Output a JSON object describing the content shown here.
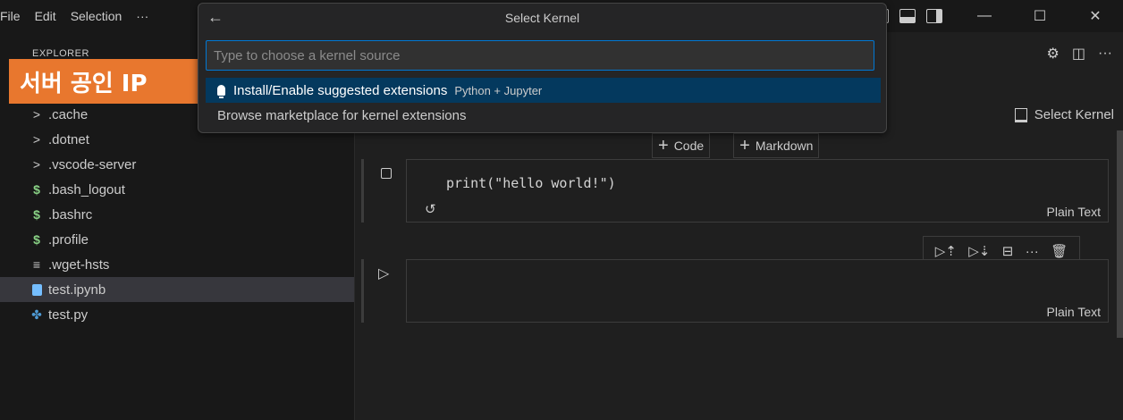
{
  "menu": [
    "File",
    "Edit",
    "Selection",
    "···"
  ],
  "window": {
    "minimize": "—",
    "maximize": "☐",
    "close": "✕"
  },
  "sidebar": {
    "title": "EXPLORER",
    "items": [
      {
        "label": ".cache",
        "icon": "chevron-right-icon",
        "glyph": ">"
      },
      {
        "label": ".dotnet",
        "icon": "chevron-right-icon",
        "glyph": ">"
      },
      {
        "label": ".vscode-server",
        "icon": "chevron-right-icon",
        "glyph": ">"
      },
      {
        "label": ".bash_logout",
        "icon": "shell-script-icon",
        "glyph": "$"
      },
      {
        "label": ".bashrc",
        "icon": "shell-script-icon",
        "glyph": "$"
      },
      {
        "label": ".profile",
        "icon": "shell-script-icon",
        "glyph": "$"
      },
      {
        "label": ".wget-hsts",
        "icon": "text-file-icon",
        "glyph": "≡"
      },
      {
        "label": "test.ipynb",
        "icon": "notebook-file-icon",
        "glyph": ""
      },
      {
        "label": "test.py",
        "icon": "python-file-icon",
        "glyph": "✤"
      }
    ]
  },
  "overlay_label": "서버 공인 IP",
  "editor": {
    "actions": [
      "⚙",
      "◫",
      "···"
    ],
    "select_kernel": "Select Kernel",
    "add_code": "Code",
    "add_markdown": "Markdown",
    "cells": [
      {
        "code": "print(\"hello world!\")",
        "language": "Plain Text"
      },
      {
        "code": "",
        "language": "Plain Text"
      }
    ],
    "cell_toolbar": [
      "▷⇡",
      "▷⇣",
      "⊟",
      "···",
      "🗑"
    ]
  },
  "quickpick": {
    "title": "Select Kernel",
    "back": "←",
    "placeholder": "Type to choose a kernel source",
    "items": [
      {
        "label": "Install/Enable suggested extensions",
        "description": "Python + Jupyter"
      },
      {
        "label": "Browse marketplace for kernel extensions",
        "description": ""
      }
    ]
  },
  "colors": {
    "accent": "#0078d4",
    "badge": "#e8772e",
    "selection": "#04395e"
  }
}
